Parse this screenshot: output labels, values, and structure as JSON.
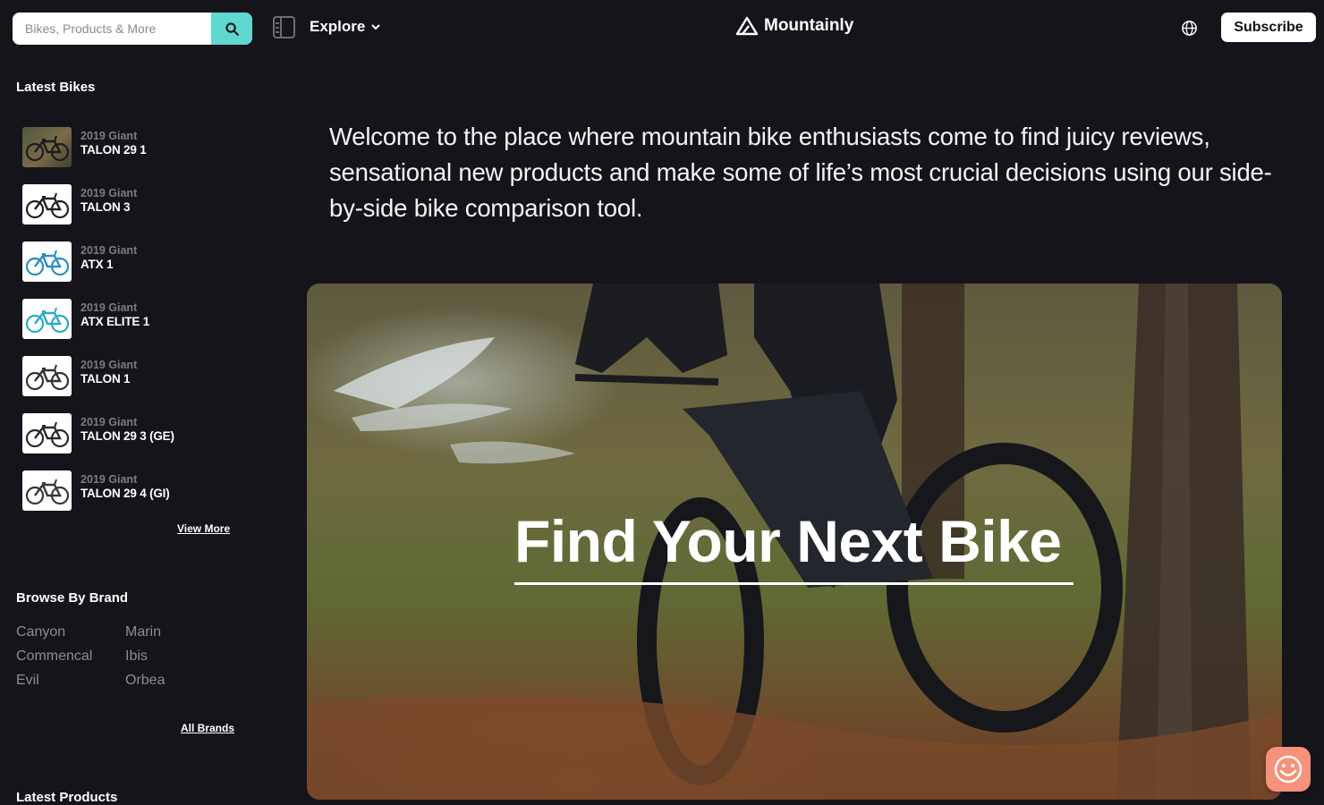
{
  "header": {
    "search_placeholder": "Bikes, Products & More",
    "explore_label": "Explore",
    "logo_text": "Mountainly",
    "subscribe_label": "Subscribe"
  },
  "sidebar": {
    "latest_bikes_title": "Latest Bikes",
    "bikes": [
      {
        "year": "2019 Giant",
        "model": "TALON 29 1",
        "color": "photo"
      },
      {
        "year": "2019 Giant",
        "model": "TALON 3",
        "color": "#222222"
      },
      {
        "year": "2019 Giant",
        "model": "ATX 1",
        "color": "#2a8fc0"
      },
      {
        "year": "2019 Giant",
        "model": "ATX ELITE 1",
        "color": "#2fa9c9"
      },
      {
        "year": "2019 Giant",
        "model": "TALON 1",
        "color": "#333333"
      },
      {
        "year": "2019 Giant",
        "model": "TALON 29 3 (GE)",
        "color": "#2b2b2b"
      },
      {
        "year": "2019 Giant",
        "model": "TALON 29 4 (GI)",
        "color": "#3a3a3a"
      }
    ],
    "view_more_label": "View More",
    "browse_brand_title": "Browse By Brand",
    "brands": [
      "Canyon",
      "Marin",
      "Commencal",
      "Ibis",
      "Evil",
      "Orbea"
    ],
    "all_brands_label": "All Brands",
    "latest_products_title": "Latest Products"
  },
  "main": {
    "intro_text": "Welcome to the place where mountain bike enthusiasts come to find juicy reviews, sensational new products and make some of life’s most crucial decisions using our side-by-side bike comparison tool.",
    "hero_title": "Find Your Next Bike"
  },
  "colors": {
    "background": "#15141b",
    "accent": "#5fd9cf",
    "chat_button": "#f6917b"
  }
}
